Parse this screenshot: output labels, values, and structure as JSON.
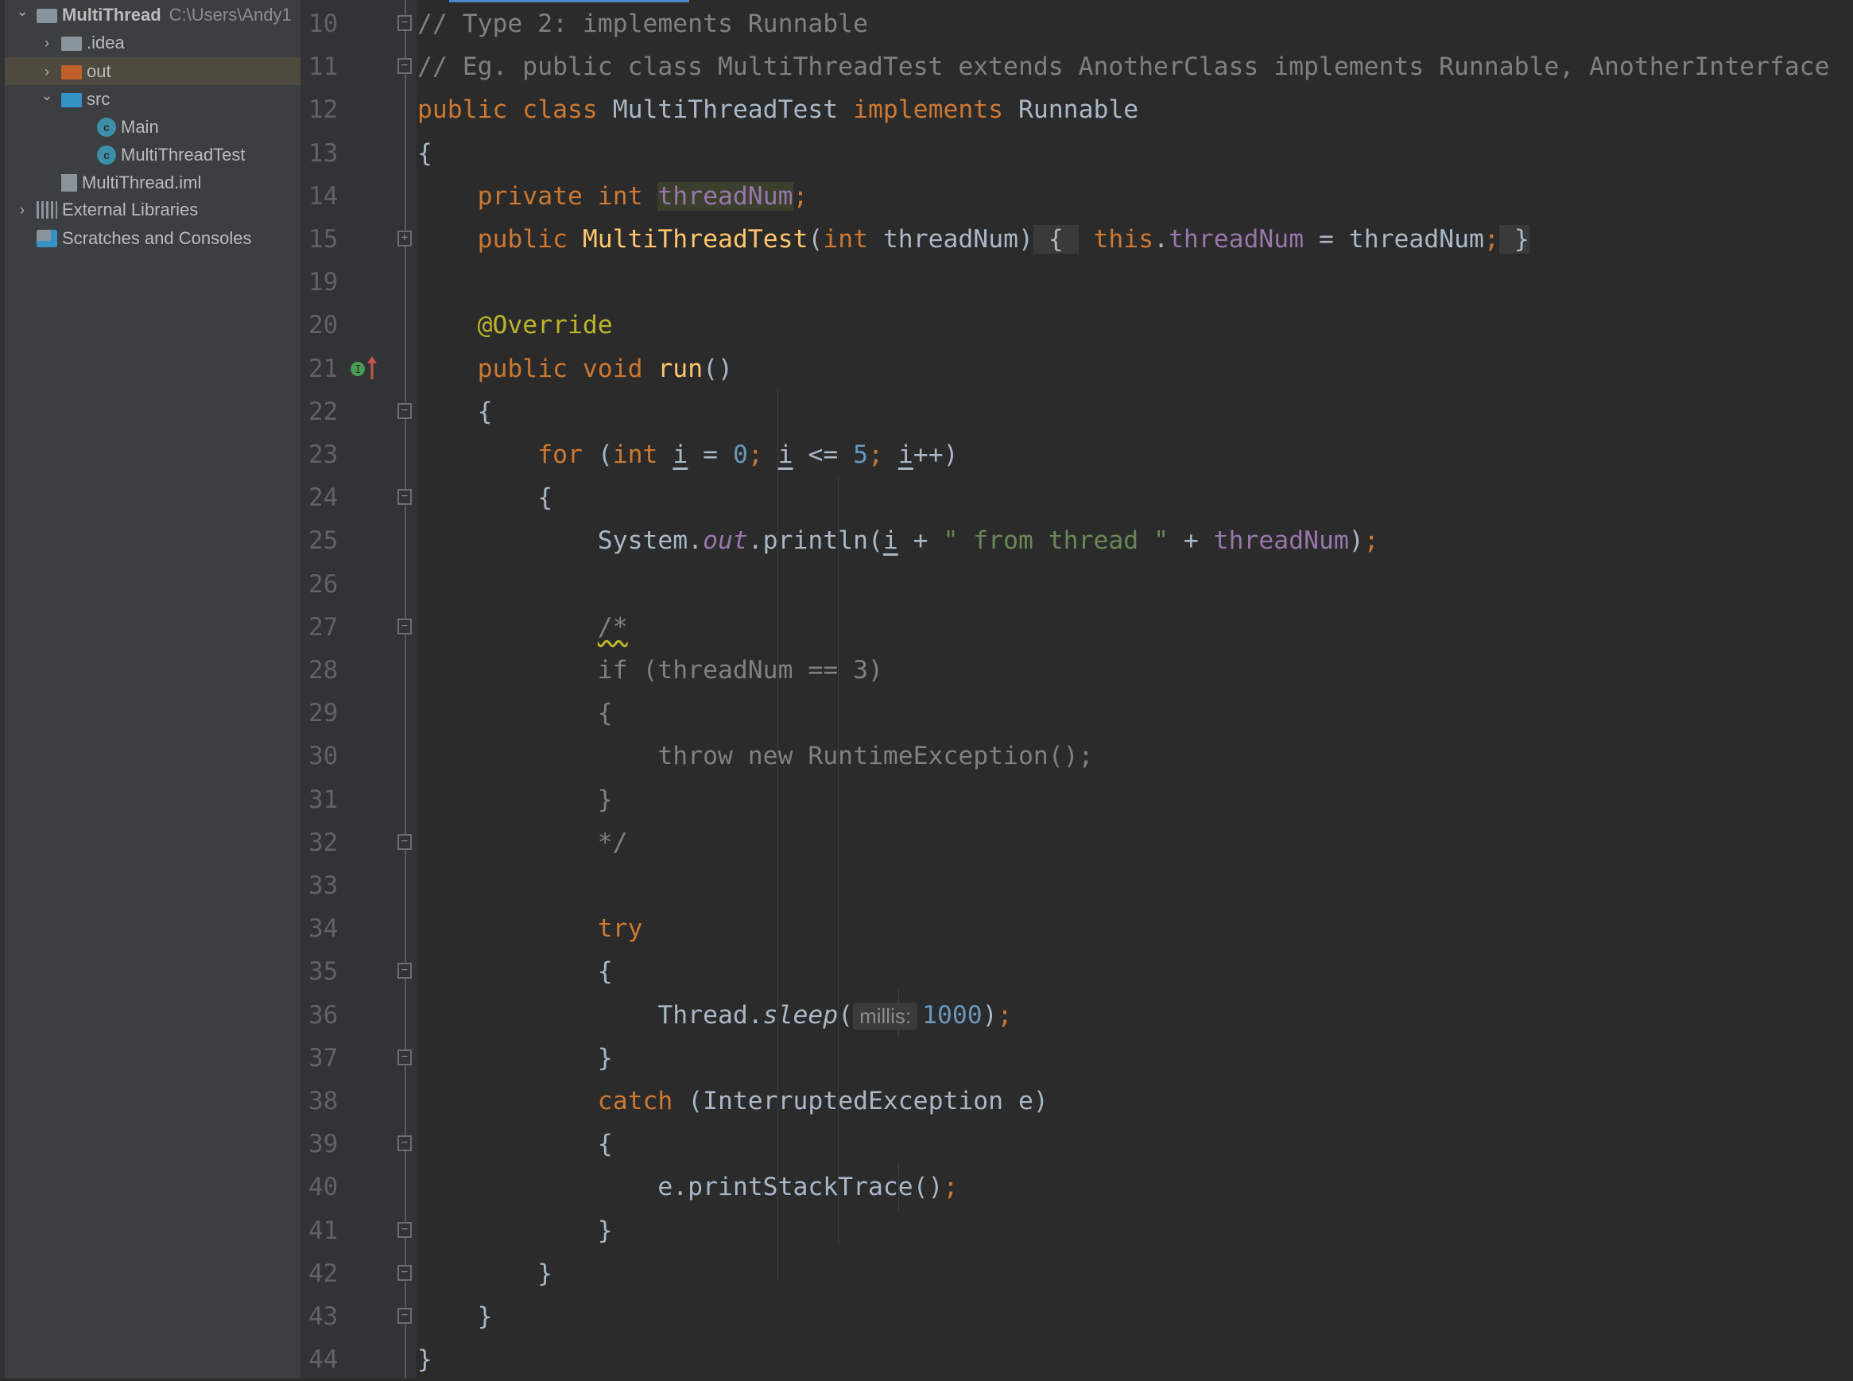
{
  "project_tree": {
    "items": [
      {
        "label": "MultiThread",
        "path": "C:\\Users\\Andy1",
        "icon": "module-folder-icon",
        "expanded": true,
        "level": 0,
        "bold": true
      },
      {
        "label": ".idea",
        "icon": "folder-icon",
        "expanded": false,
        "level": 1
      },
      {
        "label": "out",
        "icon": "excluded-folder-icon",
        "expanded": false,
        "level": 1,
        "selected": true
      },
      {
        "label": "src",
        "icon": "source-folder-icon",
        "expanded": true,
        "level": 1
      },
      {
        "label": "Main",
        "icon": "runnable-class-icon",
        "level": 2
      },
      {
        "label": "MultiThreadTest",
        "icon": "class-icon",
        "level": 2
      },
      {
        "label": "MultiThread.iml",
        "icon": "iml-file-icon",
        "level": 1
      },
      {
        "label": "External Libraries",
        "icon": "libraries-icon",
        "expanded": false,
        "level": 0
      },
      {
        "label": "Scratches and Consoles",
        "icon": "scratches-icon",
        "level": 0
      }
    ]
  },
  "colors": {
    "keyword": "#cc7832",
    "text": "#a9b7c6",
    "field": "#9876aa",
    "string": "#6a8759",
    "number": "#6897bb",
    "annotation": "#bbb529",
    "comment": "#808080",
    "accent": "#4a88c7"
  },
  "editor": {
    "lines": [
      {
        "num": "10",
        "fold": "minus",
        "tokens": [
          [
            "cm",
            "// Type 2: implements Runnable"
          ]
        ]
      },
      {
        "num": "11",
        "fold": "end",
        "tokens": [
          [
            "cm",
            "// Eg. public class MultiThreadTest extends AnotherClass implements Runnable, AnotherInterface"
          ]
        ]
      },
      {
        "num": "12",
        "tokens": [
          [
            "kw",
            "public class "
          ],
          [
            "",
            "MultiThreadTest "
          ],
          [
            "kw",
            "implements "
          ],
          [
            "",
            "Runnable"
          ]
        ]
      },
      {
        "num": "13",
        "tokens": [
          [
            "",
            "{"
          ]
        ]
      },
      {
        "num": "14",
        "tokens": [
          [
            "",
            "    "
          ],
          [
            "kw",
            "private int "
          ],
          [
            "fld hl",
            "threadNum"
          ],
          [
            "kw",
            ";"
          ]
        ]
      },
      {
        "num": "15",
        "fold": "plus",
        "tokens": [
          [
            "",
            "    "
          ],
          [
            "kw",
            "public "
          ],
          [
            "fn",
            "MultiThreadTest"
          ],
          [
            "",
            "("
          ],
          [
            "kw",
            "int "
          ],
          [
            "",
            "threadNum)"
          ],
          [
            "fold",
            " { "
          ],
          [
            "kw",
            " this"
          ],
          [
            "",
            "."
          ],
          [
            "fld",
            "threadNum"
          ],
          [
            "",
            " = threadNum"
          ],
          [
            "kw",
            ";"
          ],
          [
            "fold",
            " }"
          ]
        ]
      },
      {
        "num": "19",
        "tokens": []
      },
      {
        "num": "20",
        "tokens": [
          [
            "",
            "    "
          ],
          [
            "ann",
            "@Override"
          ]
        ]
      },
      {
        "num": "21",
        "gutter_icon": "implements-method-icon",
        "tokens": [
          [
            "",
            "    "
          ],
          [
            "kw",
            "public void "
          ],
          [
            "fn",
            "run"
          ],
          [
            "",
            "()"
          ]
        ]
      },
      {
        "num": "22",
        "fold": "minus",
        "tokens": [
          [
            "",
            "    {"
          ]
        ]
      },
      {
        "num": "23",
        "tokens": [
          [
            "",
            "        "
          ],
          [
            "kw",
            "for "
          ],
          [
            "",
            "("
          ],
          [
            "kw",
            "int "
          ],
          [
            "iv",
            "i"
          ],
          [
            "",
            " = "
          ],
          [
            "num",
            "0"
          ],
          [
            "kw",
            "; "
          ],
          [
            "iv",
            "i"
          ],
          [
            "",
            " <= "
          ],
          [
            "num",
            "5"
          ],
          [
            "kw",
            "; "
          ],
          [
            "iv",
            "i"
          ],
          [
            "",
            "++)"
          ]
        ]
      },
      {
        "num": "24",
        "fold": "minus",
        "tokens": [
          [
            "",
            "        {"
          ]
        ]
      },
      {
        "num": "25",
        "tokens": [
          [
            "",
            "            System."
          ],
          [
            "it",
            "out"
          ],
          [
            "",
            ".println("
          ],
          [
            "iv",
            "i"
          ],
          [
            "",
            " + "
          ],
          [
            "str",
            "\" from thread \""
          ],
          [
            "",
            " + "
          ],
          [
            "fld",
            "threadNum"
          ],
          [
            "",
            ")"
          ],
          [
            "kw",
            ";"
          ]
        ]
      },
      {
        "num": "26",
        "tokens": []
      },
      {
        "num": "27",
        "fold": "minus",
        "tokens": [
          [
            "",
            "            "
          ],
          [
            "cm wavy",
            "/*"
          ]
        ]
      },
      {
        "num": "28",
        "tokens": [
          [
            "cm",
            "            if (threadNum == 3)"
          ]
        ]
      },
      {
        "num": "29",
        "tokens": [
          [
            "cm",
            "            {"
          ]
        ]
      },
      {
        "num": "30",
        "tokens": [
          [
            "cm",
            "                throw new RuntimeException();"
          ]
        ]
      },
      {
        "num": "31",
        "tokens": [
          [
            "cm",
            "            }"
          ]
        ]
      },
      {
        "num": "32",
        "fold": "end",
        "tokens": [
          [
            "cm",
            "            */"
          ]
        ]
      },
      {
        "num": "33",
        "tokens": []
      },
      {
        "num": "34",
        "tokens": [
          [
            "",
            "            "
          ],
          [
            "kw",
            "try"
          ]
        ]
      },
      {
        "num": "35",
        "fold": "minus",
        "tokens": [
          [
            "",
            "            {"
          ]
        ]
      },
      {
        "num": "36",
        "tokens": [
          [
            "",
            "                Thread."
          ],
          [
            "iti",
            "sleep"
          ],
          [
            "",
            "("
          ],
          [
            "hint",
            "millis:"
          ],
          [
            "num",
            "1000"
          ],
          [
            "",
            ")"
          ],
          [
            "kw",
            ";"
          ]
        ]
      },
      {
        "num": "37",
        "fold": "end",
        "tokens": [
          [
            "",
            "            }"
          ]
        ]
      },
      {
        "num": "38",
        "tokens": [
          [
            "",
            "            "
          ],
          [
            "kw",
            "catch "
          ],
          [
            "",
            "(InterruptedException e)"
          ]
        ]
      },
      {
        "num": "39",
        "fold": "minus",
        "tokens": [
          [
            "",
            "            {"
          ]
        ]
      },
      {
        "num": "40",
        "tokens": [
          [
            "",
            "                e.printStackTrace()"
          ],
          [
            "kw",
            ";"
          ]
        ]
      },
      {
        "num": "41",
        "fold": "end",
        "tokens": [
          [
            "",
            "            }"
          ]
        ]
      },
      {
        "num": "42",
        "fold": "end",
        "tokens": [
          [
            "",
            "        }"
          ]
        ]
      },
      {
        "num": "43",
        "fold": "end",
        "tokens": [
          [
            "",
            "    }"
          ]
        ]
      },
      {
        "num": "44",
        "tokens": [
          [
            "",
            "}"
          ]
        ]
      }
    ]
  }
}
